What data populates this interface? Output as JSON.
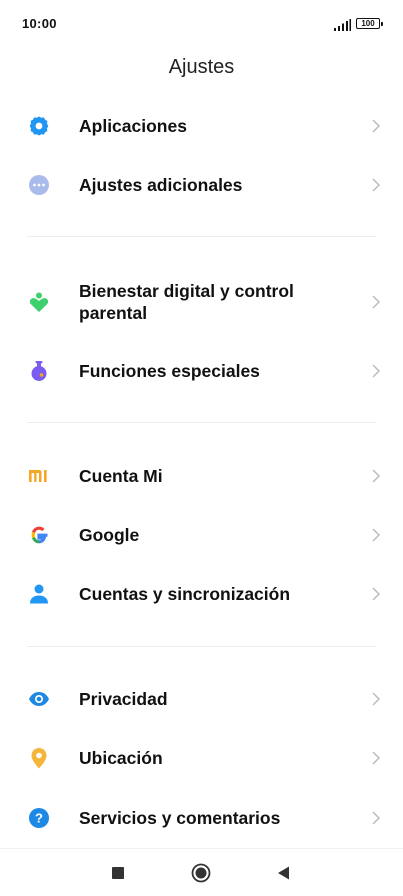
{
  "status_bar": {
    "time": "10:00",
    "battery": "100",
    "signal_icon": "signal-bars-icon"
  },
  "header": {
    "title": "Ajustes"
  },
  "groups": [
    {
      "items": [
        {
          "label": "Aplicaciones",
          "icon": "gear-icon",
          "color": "#2196f3"
        },
        {
          "label": "Ajustes adicionales",
          "icon": "more-dots-icon",
          "color": "#9fb3e8"
        }
      ]
    },
    {
      "items": [
        {
          "label": "Bienestar digital y control parental",
          "icon": "wellbeing-heart-icon",
          "color": "#3ecf6e"
        },
        {
          "label": "Funciones especiales",
          "icon": "flask-icon",
          "color": "#7a5cf0"
        }
      ]
    },
    {
      "items": [
        {
          "label": "Cuenta Mi",
          "icon": "mi-logo-icon",
          "color": "#f5a623"
        },
        {
          "label": "Google",
          "icon": "google-logo-icon",
          "color": "#4285f4"
        },
        {
          "label": "Cuentas y sincronización",
          "icon": "person-icon",
          "color": "#2196f3"
        }
      ]
    },
    {
      "items": [
        {
          "label": "Privacidad",
          "icon": "eye-icon",
          "color": "#1e88e5"
        },
        {
          "label": "Ubicación",
          "icon": "location-pin-icon",
          "color": "#f5b53a"
        },
        {
          "label": "Servicios y comentarios",
          "icon": "help-question-icon",
          "color": "#1e88e5"
        }
      ]
    }
  ],
  "nav_bar": {
    "recents_icon": "square-recents-icon",
    "home_icon": "circle-home-icon",
    "back_icon": "triangle-back-icon"
  }
}
